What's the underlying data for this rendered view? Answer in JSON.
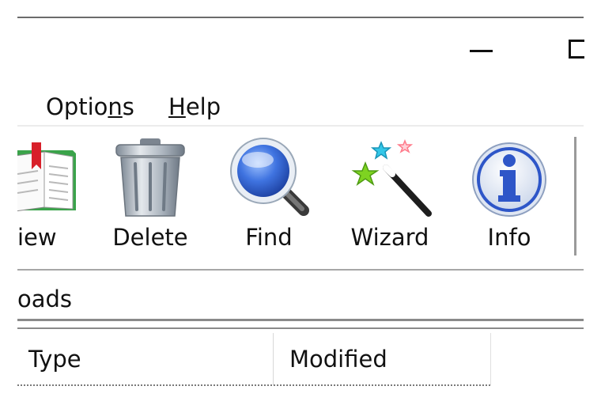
{
  "window": {
    "controls": {
      "minimize": "minimize-icon",
      "maximize": "maximize-icon"
    }
  },
  "menu": {
    "options": {
      "pre": "Optio",
      "accel": "n",
      "post": "s"
    },
    "help": {
      "pre": "",
      "accel": "H",
      "post": "elp"
    }
  },
  "toolbar": {
    "buttons": [
      {
        "label": "iew",
        "icon": "book-icon"
      },
      {
        "label": "Delete",
        "icon": "trash-icon"
      },
      {
        "label": "Find",
        "icon": "magnifier-icon"
      },
      {
        "label": "Wizard",
        "icon": "wand-icon"
      },
      {
        "label": "Info",
        "icon": "info-icon"
      }
    ]
  },
  "address": {
    "text": "oads"
  },
  "list": {
    "columns": [
      "Type",
      "Modified"
    ]
  },
  "colors": {
    "book_green": "#3aa34a",
    "book_red": "#d8202a",
    "magnifier_blue": "#2f5fd0",
    "info_blue": "#2e56c8",
    "star_cyan": "#33c7e8",
    "star_green": "#7ed321",
    "star_pink": "#ff7a8a"
  }
}
